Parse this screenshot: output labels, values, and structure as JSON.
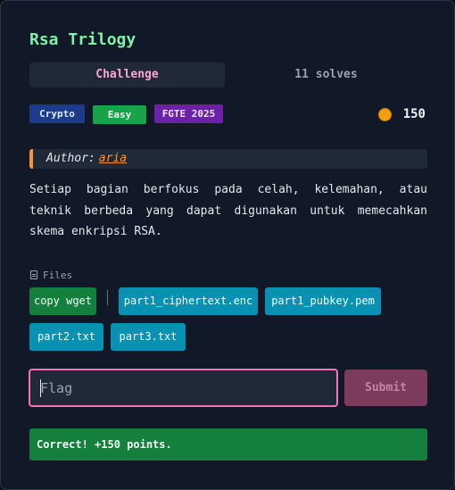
{
  "challenge": {
    "title": "Rsa Trilogy",
    "tabs": [
      {
        "label": "Challenge",
        "active": true
      },
      {
        "label": "11 solves",
        "active": false
      }
    ],
    "tags": {
      "category": "Crypto",
      "difficulty": "Easy",
      "event": "FGTE 2025"
    },
    "points": "150",
    "author_prefix": "Author:",
    "author_name": "aria",
    "description": "Setiap bagian berfokus pada celah, kelemahan, atau teknik berbeda yang dapat digunakan untuk memecahkan skema enkripsi RSA."
  },
  "files": {
    "label": "Files",
    "copy_wget": "copy wget",
    "items": [
      "part1_ciphertext.enc",
      "part1_pubkey.pem",
      "part2.txt",
      "part3.txt"
    ]
  },
  "submit_form": {
    "placeholder": "Flag",
    "button_label": "Submit"
  },
  "status": {
    "message": "Correct! +150 points."
  },
  "colors": {
    "accent_title": "#86efac",
    "accent_tab": "#f9a8d4",
    "file_button": "#0891b2",
    "success": "#15803d",
    "input_border": "#f472b6"
  }
}
